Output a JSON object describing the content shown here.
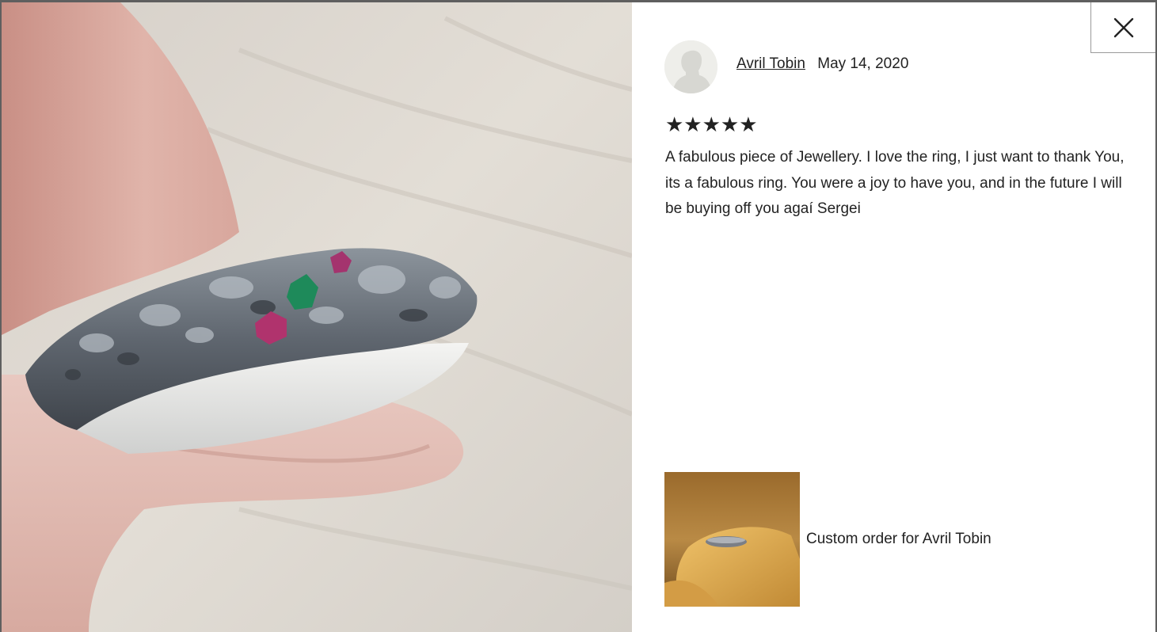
{
  "review": {
    "reviewer_name": "Avril Tobin",
    "date": "May 14, 2020",
    "rating": 5,
    "stars": "★★★★★",
    "text": "A fabulous piece of Jewellery. I love the ring, I just want to thank You, its a fabulous ring. You were a joy to have you, and in the future I will be buying off you agaí Sergei"
  },
  "order": {
    "label": "Custom order for Avril Tobin"
  },
  "icons": {
    "close": "close-icon",
    "avatar": "avatar-silhouette-icon"
  }
}
